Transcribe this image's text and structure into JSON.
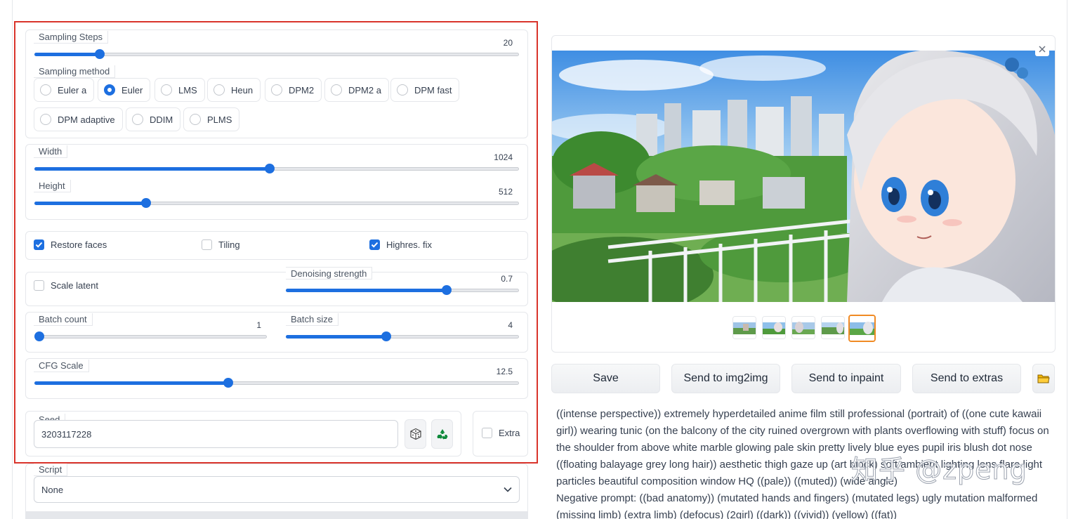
{
  "sampling_steps": {
    "label": "Sampling Steps",
    "value": "20",
    "fraction": 0.135
  },
  "sampling_method": {
    "label": "Sampling method",
    "options": [
      "Euler a",
      "Euler",
      "LMS",
      "Heun",
      "DPM2",
      "DPM2 a",
      "DPM fast",
      "DPM adaptive",
      "DDIM",
      "PLMS"
    ],
    "selected": "Euler"
  },
  "width": {
    "label": "Width",
    "value": "1024",
    "fraction": 0.485
  },
  "height": {
    "label": "Height",
    "value": "512",
    "fraction": 0.23
  },
  "checks": {
    "restore_faces": "Restore faces",
    "tiling": "Tiling",
    "highres_fix": "Highres. fix",
    "scale_latent": "Scale latent",
    "extra": "Extra"
  },
  "check_state": {
    "restore_faces": true,
    "tiling": false,
    "highres_fix": true,
    "scale_latent": false,
    "extra": false
  },
  "denoising": {
    "label": "Denoising strength",
    "value": "0.7",
    "fraction": 0.69
  },
  "batch_count": {
    "label": "Batch count",
    "value": "1",
    "fraction": 0.0
  },
  "batch_size": {
    "label": "Batch size",
    "value": "4",
    "fraction": 0.43
  },
  "cfg_scale": {
    "label": "CFG Scale",
    "value": "12.5",
    "fraction": 0.4
  },
  "seed": {
    "label": "Seed",
    "value": "3203117228"
  },
  "script": {
    "label": "Script",
    "value": "None"
  },
  "actions": {
    "save": "Save",
    "img2img": "Send to img2img",
    "inpaint": "Send to inpaint",
    "extras": "Send to extras"
  },
  "output": {
    "prompt": "((intense perspective)) extremely hyperdetailed anime film still professional (portrait) of ((one cute kawaii girl)) wearing tunic (on the balcony of the city ruined overgrown with plants overflowing with stuff) focus on the shoulder from above white marble glowing pale skin pretty lively blue eyes pupil iris blush dot nose ((floating balayage grey long hair)) aesthetic thigh gaze up (art block) soft ambient lighting lens flare light particles beautiful composition window HQ ((pale)) ((muted)) (wide angle)",
    "negative": "Negative prompt: ((bad anatomy)) (mutated hands and fingers) (mutated legs) ugly mutation malformed (missing limb) (extra limb) (defocus) (2girl) ((dark)) ((vivid)) (yellow) ((fat))"
  },
  "watermark": "知乎 @zpeng",
  "colors": {
    "accent": "#1d6fe0",
    "highlight_border": "#d9342b",
    "selected_thumb": "#f08a24"
  }
}
